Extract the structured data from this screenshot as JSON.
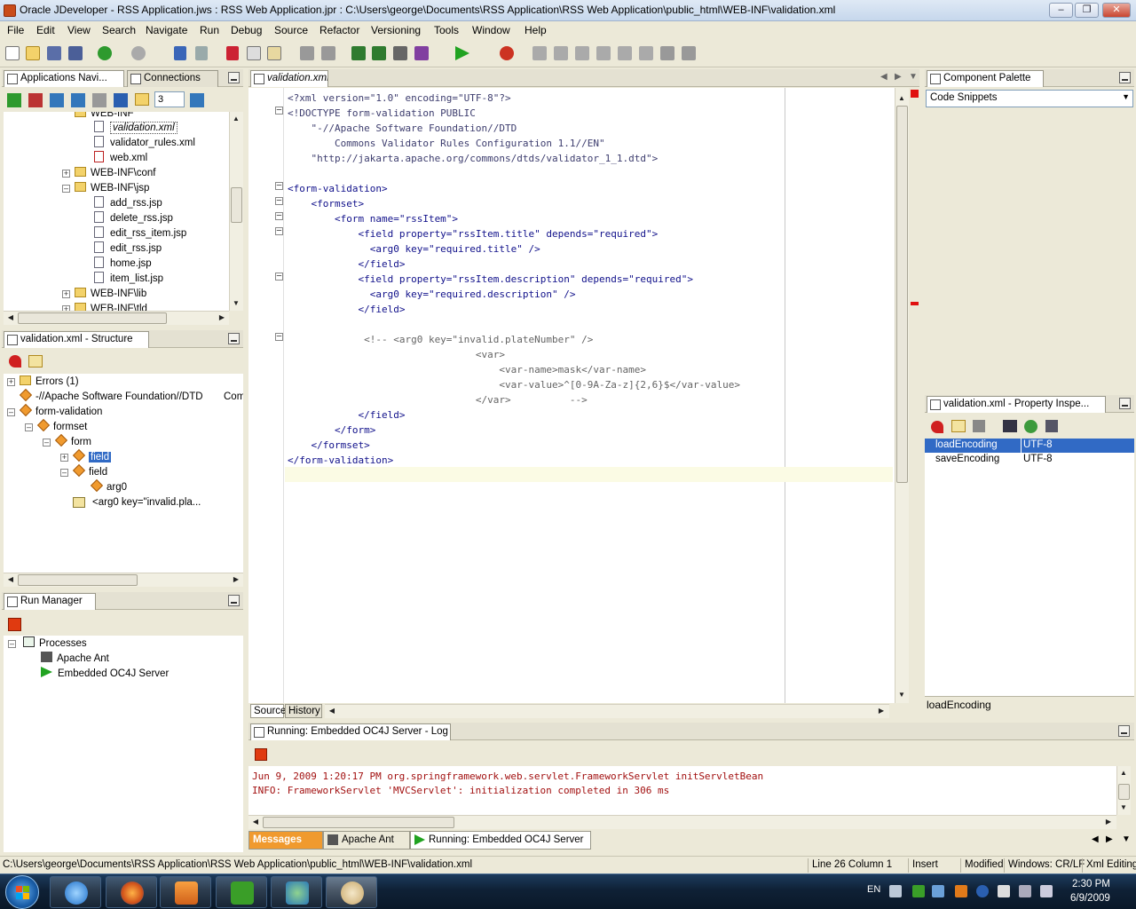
{
  "window": {
    "title": "Oracle JDeveloper - RSS Application.jws : RSS Web Application.jpr : C:\\Users\\george\\Documents\\RSS Application\\RSS Web Application\\public_html\\WEB-INF\\validation.xml"
  },
  "menu": [
    "File",
    "Edit",
    "View",
    "Search",
    "Navigate",
    "Run",
    "Debug",
    "Source",
    "Refactor",
    "Versioning",
    "Tools",
    "Window",
    "Help"
  ],
  "navigator": {
    "tabs": [
      "Applications Navi...",
      "Connections"
    ],
    "spinner_value": "3",
    "items": [
      {
        "label": "WEB-INF",
        "type": "folder"
      },
      {
        "label": "validation.xml",
        "type": "xml",
        "selected": true
      },
      {
        "label": "validator_rules.xml",
        "type": "xml"
      },
      {
        "label": "web.xml",
        "type": "xml"
      },
      {
        "label": "WEB-INF\\conf",
        "type": "folder"
      },
      {
        "label": "WEB-INF\\jsp",
        "type": "folder"
      },
      {
        "label": "add_rss.jsp",
        "type": "jsp"
      },
      {
        "label": "delete_rss.jsp",
        "type": "jsp"
      },
      {
        "label": "edit_rss_item.jsp",
        "type": "jsp"
      },
      {
        "label": "edit_rss.jsp",
        "type": "jsp"
      },
      {
        "label": "home.jsp",
        "type": "jsp"
      },
      {
        "label": "item_list.jsp",
        "type": "jsp"
      },
      {
        "label": "WEB-INF\\lib",
        "type": "folder"
      },
      {
        "label": "WEB-INF\\tld",
        "type": "folder"
      }
    ]
  },
  "structure": {
    "tab": "validation.xml - Structure",
    "items": [
      {
        "label": "Errors (1)"
      },
      {
        "label": "-//Apache Software Foundation//DTD",
        "extra": "Comm"
      },
      {
        "label": "form-validation"
      },
      {
        "label": "formset"
      },
      {
        "label": "form"
      },
      {
        "label": "field",
        "selected": true
      },
      {
        "label": "field"
      },
      {
        "label": "arg0"
      },
      {
        "label": "<arg0 key=\"invalid.pla..."
      }
    ]
  },
  "run_manager": {
    "tab": "Run Manager",
    "items": [
      "Processes",
      "Apache Ant",
      "Embedded OC4J Server"
    ]
  },
  "editor": {
    "tab": "validation.xml",
    "bottom_tabs": [
      "Source",
      "History"
    ],
    "lines": [
      "<?xml version=\"1.0\" encoding=\"UTF-8\"?>",
      "<!DOCTYPE form-validation PUBLIC",
      "    \"-//Apache Software Foundation//DTD",
      "        Commons Validator Rules Configuration 1.1//EN\"",
      "    \"http://jakarta.apache.org/commons/dtds/validator_1_1.dtd\">",
      "",
      "<form-validation>",
      "    <formset>",
      "        <form name=\"rssItem\">",
      "            <field property=\"rssItem.title\" depends=\"required\">",
      "              <arg0 key=\"required.title\" />",
      "            </field>",
      "            <field property=\"rssItem.description\" depends=\"required\">",
      "              <arg0 key=\"required.description\" />",
      "            </field>",
      "",
      "             <!-- <arg0 key=\"invalid.plateNumber\" />",
      "                                <var>",
      "                                    <var-name>mask</var-name>",
      "                                    <var-value>^[0-9A-Za-z]{2,6}$</var-value>",
      "                                </var>          -->",
      "            </field>",
      "        </form>",
      "    </formset>",
      "</form-validation>",
      ""
    ]
  },
  "palette": {
    "tab": "Component Palette",
    "dropdown": "Code Snippets"
  },
  "property_inspector": {
    "tab": "validation.xml - Property Inspe...",
    "rows": [
      {
        "name": "loadEncoding",
        "value": "UTF-8",
        "selected": true
      },
      {
        "name": "saveEncoding",
        "value": "UTF-8"
      }
    ],
    "description": "loadEncoding"
  },
  "log": {
    "tab": "Running: Embedded OC4J Server - Log",
    "lines": [
      "Jun 9, 2009 1:20:17 PM org.springframework.web.servlet.FrameworkServlet initServletBean",
      "INFO: FrameworkServlet 'MVCServlet': initialization completed in 306 ms"
    ],
    "bottom_tabs": [
      "Messages",
      "Apache Ant",
      "Running: Embedded OC4J Server"
    ]
  },
  "status": {
    "path": "C:\\Users\\george\\Documents\\RSS Application\\RSS Web Application\\public_html\\WEB-INF\\validation.xml",
    "position": "Line 26 Column 1",
    "mode": "Insert",
    "modified": "Modified",
    "line_endings": "Windows: CR/LF",
    "editor_mode": "Xml Editing"
  },
  "taskbar": {
    "language": "EN",
    "time": "2:30 PM",
    "date": "6/9/2009"
  },
  "colors": {
    "selection": "#316ac5",
    "accent_orange": "#f09a2e",
    "log_text": "#a21010"
  }
}
